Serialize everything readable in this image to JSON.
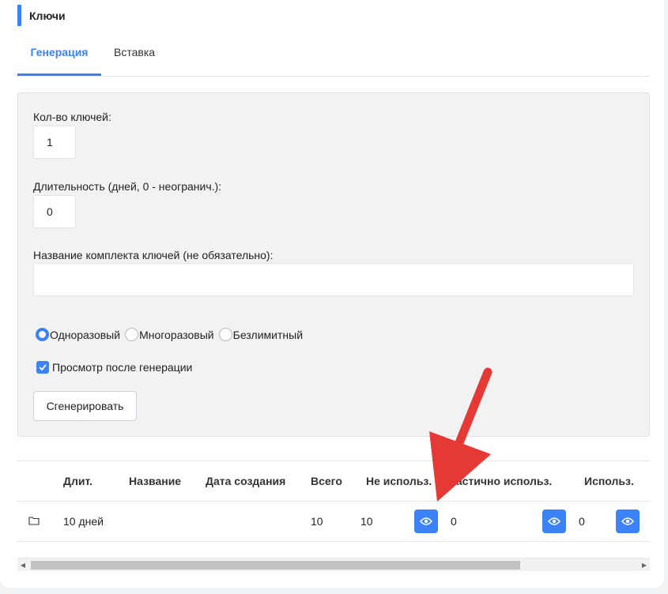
{
  "card": {
    "title": "Ключи"
  },
  "tabs": [
    {
      "label": "Генерация",
      "active": true
    },
    {
      "label": "Вставка",
      "active": false
    }
  ],
  "form": {
    "count_label": "Кол-во ключей:",
    "count_value": "1",
    "duration_label": "Длительность (дней, 0 - неогранич.):",
    "duration_value": "0",
    "name_label": "Название комплекта ключей (не обязательно):",
    "name_value": "",
    "radios": [
      {
        "label": "Одноразовый",
        "checked": true
      },
      {
        "label": "Многоразовый",
        "checked": false
      },
      {
        "label": "Безлимитный",
        "checked": false
      }
    ],
    "view_after_label": "Просмотр после генерации",
    "view_after_checked": true,
    "generate_label": "Сгенерировать"
  },
  "table": {
    "headers": [
      "Длит.",
      "Название",
      "Дата создания",
      "Всего",
      "Не использ.",
      "Частично использ.",
      "Использ."
    ],
    "rows": [
      {
        "icon": "folder-icon",
        "duration": "10 дней",
        "name": "",
        "created": "",
        "total": "10",
        "unused": "10",
        "partial": "0",
        "used": "0"
      }
    ]
  },
  "colors": {
    "accent": "#3b82f6",
    "annotation_arrow": "#e53935"
  },
  "icons": [
    "folder-icon",
    "eye-icon",
    "check-icon",
    "arrow-left-icon",
    "arrow-right-icon"
  ]
}
